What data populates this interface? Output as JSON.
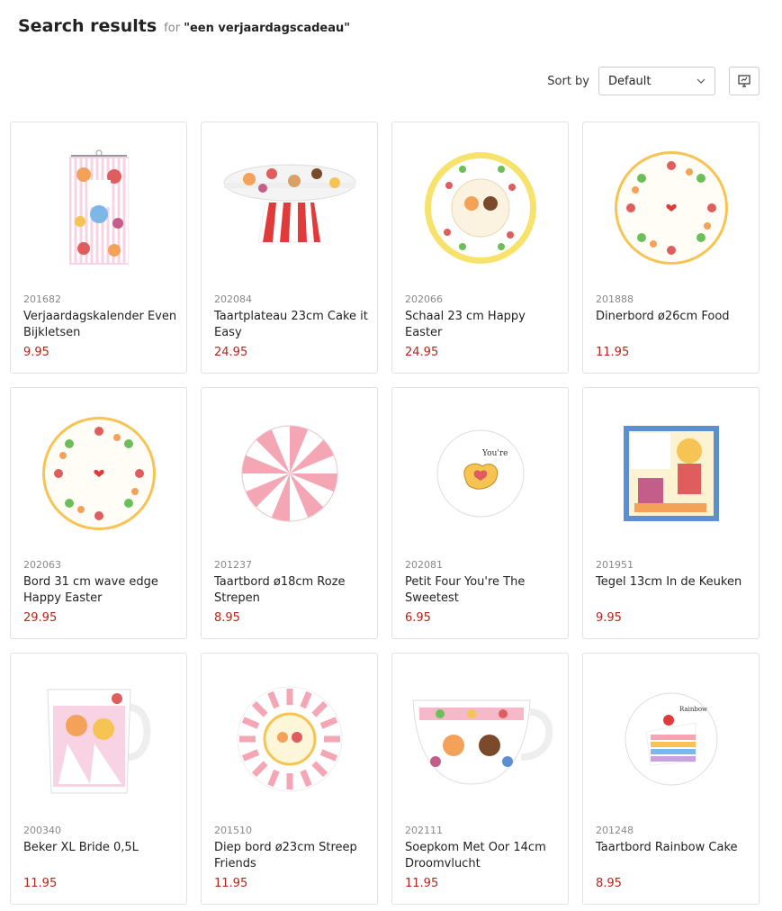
{
  "header": {
    "title": "Search results",
    "for_label": "for",
    "query": "\"een verjaardagscadeau\""
  },
  "sort": {
    "label": "Sort by",
    "selected": "Default"
  },
  "products": [
    {
      "code": "201682",
      "name": "Verjaardagskalender Even Bijkletsen",
      "price": "9.95",
      "icon": "calendar-icon"
    },
    {
      "code": "202084",
      "name": "Taartplateau 23cm Cake it Easy",
      "price": "24.95",
      "icon": "cake-stand-icon"
    },
    {
      "code": "202066",
      "name": "Schaal 23 cm Happy Easter",
      "price": "24.95",
      "icon": "bowl-icon"
    },
    {
      "code": "201888",
      "name": "Dinerbord ø26cm Food",
      "price": "11.95",
      "icon": "plate-icon"
    },
    {
      "code": "202063",
      "name": "Bord 31 cm wave edge Happy Easter",
      "price": "29.95",
      "icon": "plate-icon"
    },
    {
      "code": "201237",
      "name": "Taartbord ø18cm Roze Strepen",
      "price": "8.95",
      "icon": "striped-plate-icon"
    },
    {
      "code": "202081",
      "name": "Petit Four You're The Sweetest",
      "price": "6.95",
      "icon": "small-plate-icon"
    },
    {
      "code": "201951",
      "name": "Tegel 13cm In de Keuken",
      "price": "9.95",
      "icon": "tile-icon"
    },
    {
      "code": "200340",
      "name": "Beker XL Bride 0,5L",
      "price": "11.95",
      "icon": "mug-icon"
    },
    {
      "code": "201510",
      "name": "Diep bord ø23cm Streep Friends",
      "price": "11.95",
      "icon": "striped-bowl-icon"
    },
    {
      "code": "202111",
      "name": "Soepkom Met Oor 14cm Droomvlucht",
      "price": "11.95",
      "icon": "soup-cup-icon"
    },
    {
      "code": "201248",
      "name": "Taartbord Rainbow Cake",
      "price": "8.95",
      "icon": "cake-plate-icon"
    }
  ]
}
